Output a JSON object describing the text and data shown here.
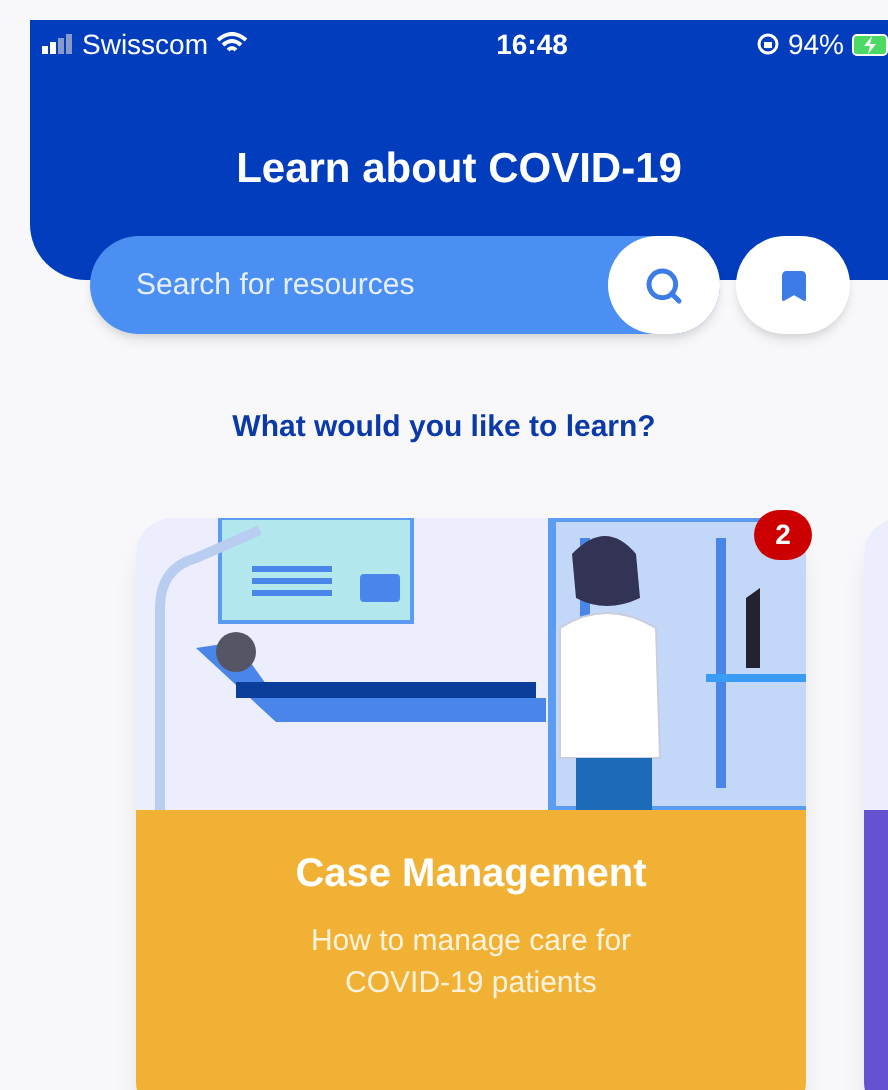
{
  "status_bar": {
    "carrier": "Swisscom",
    "time": "16:48",
    "battery": "94%"
  },
  "header": {
    "title": "Learn about COVID-19"
  },
  "search": {
    "placeholder": "Search for resources"
  },
  "prompt": "What would you like to learn?",
  "cards": [
    {
      "title": "Case Management",
      "description": "How to manage care for COVID-19 patients",
      "badge": "2",
      "color": "#f0b135"
    },
    {
      "color": "#6552d0"
    }
  ]
}
